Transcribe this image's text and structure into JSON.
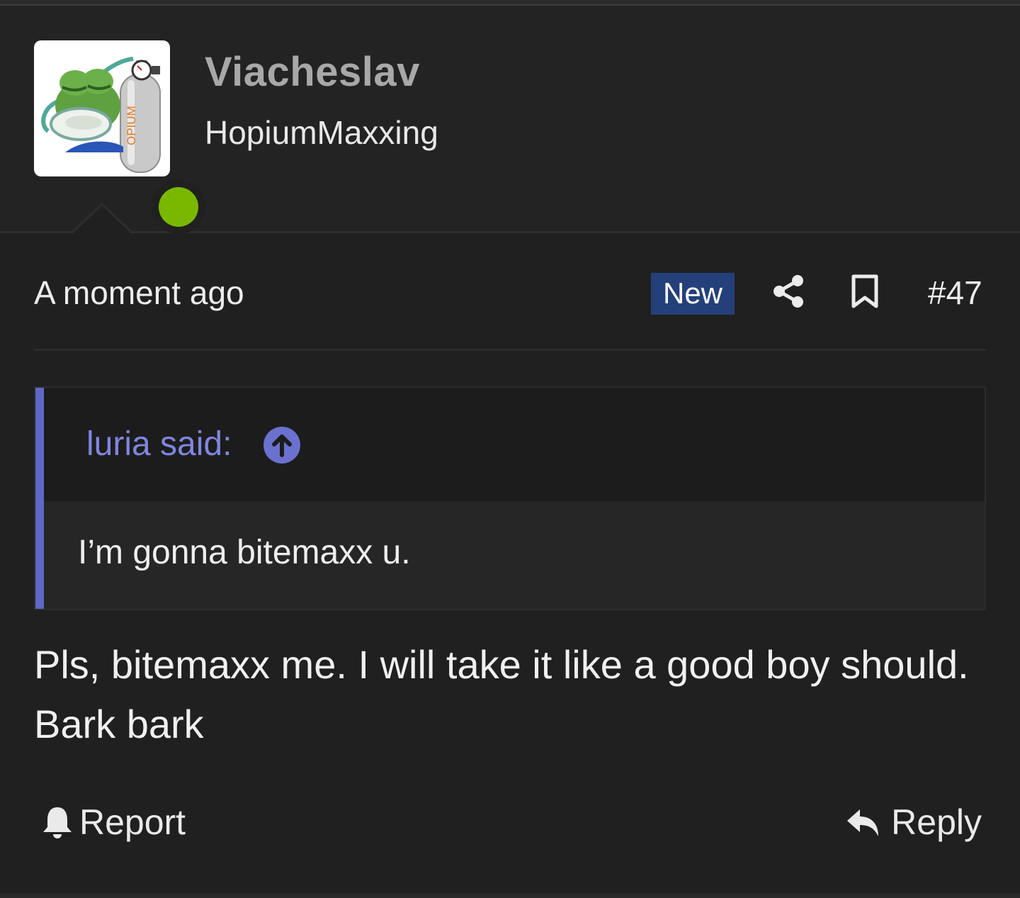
{
  "user": {
    "name": "Viacheslav",
    "title": "HopiumMaxxing",
    "avatar_tank_label": "OPIUM",
    "online_color": "#7ab800"
  },
  "post": {
    "time": "A moment ago",
    "badge": "New",
    "number": "#47",
    "body": "Pls, bitemaxx me. I will take it like a good boy should. Bark bark"
  },
  "quote": {
    "author": "luria said:",
    "text": "I’m gonna bitemaxx u."
  },
  "actions": {
    "report": "Report",
    "reply": "Reply"
  },
  "icons": {
    "share": "share-icon",
    "bookmark": "bookmark-icon",
    "jump": "arrow-up-circle-icon",
    "report": "bell-icon",
    "reply": "reply-arrow-icon"
  },
  "colors": {
    "background": "#202020",
    "badge": "#24407a",
    "quote_accent": "#5f68c6"
  }
}
